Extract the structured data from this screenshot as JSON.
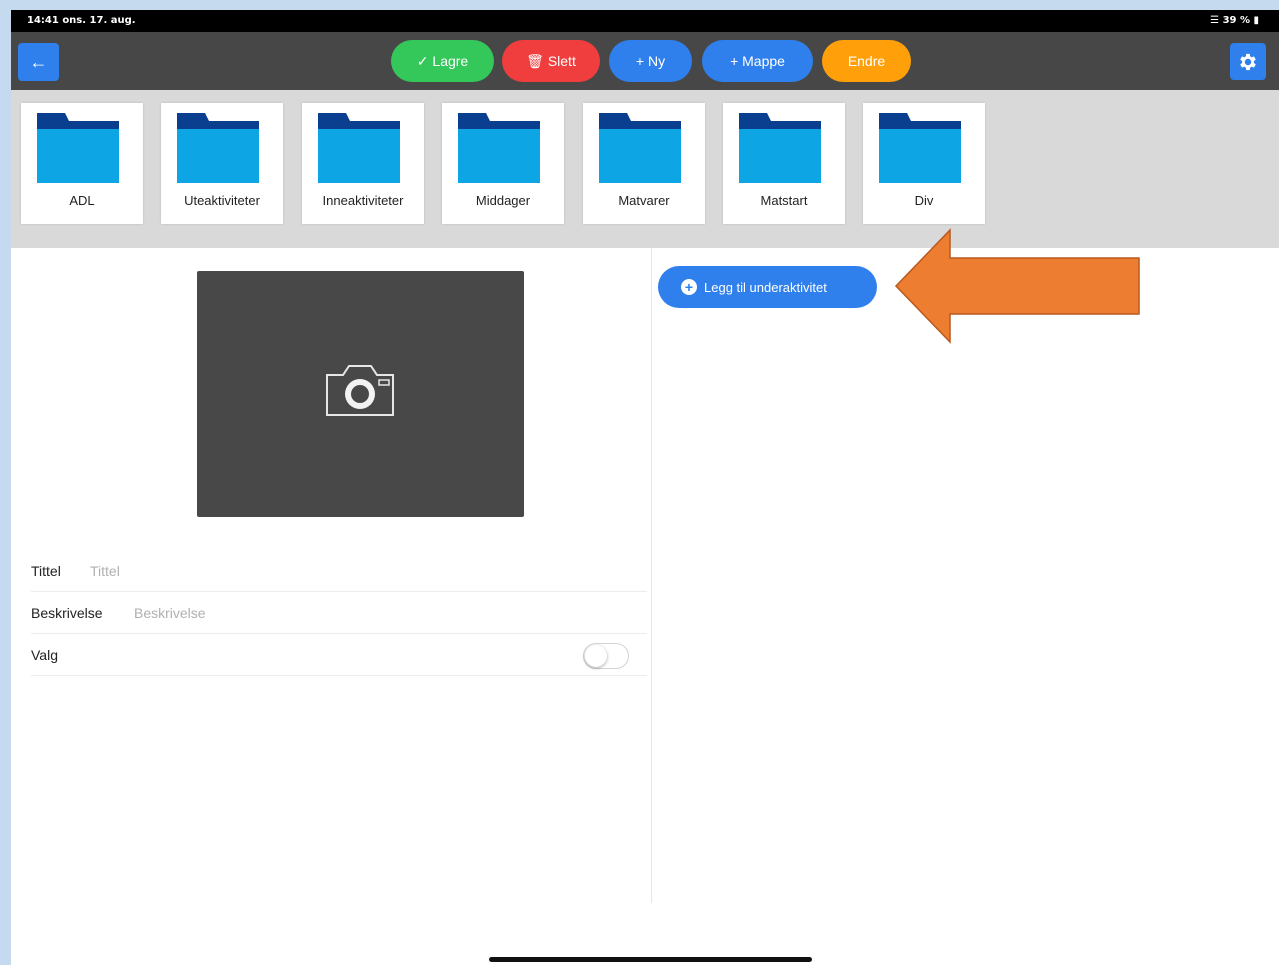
{
  "status_bar": {
    "time": "14:41  ons. 17. aug.",
    "battery": "39 %"
  },
  "toolbar": {
    "back_icon": "arrow-left",
    "buttons": [
      {
        "label": "✓ Lagre",
        "color": "#34c759"
      },
      {
        "label": "🗑 Slett",
        "color": "#f03e3e"
      },
      {
        "label": "+ Ny",
        "color": "#2f80ec"
      },
      {
        "label": "+ Mappe",
        "color": "#2f80ec"
      },
      {
        "label": "Endre",
        "color": "#ff9f0a"
      }
    ],
    "settings_icon": "gear"
  },
  "folders": [
    "ADL",
    "Uteaktiviteter",
    "Inneaktiviteter",
    "Middager",
    "Matvarer",
    "Matstart",
    "Div"
  ],
  "form": {
    "title_label": "Tittel",
    "title_placeholder": "Tittel",
    "description_label": "Beskrivelse",
    "description_placeholder": "Beskrivelse",
    "choice_label": "Valg",
    "choice_on": false
  },
  "subactivity": {
    "add_label": "Legg til underaktivitet"
  },
  "annotation": {
    "arrow_color": "#ed7d31"
  }
}
